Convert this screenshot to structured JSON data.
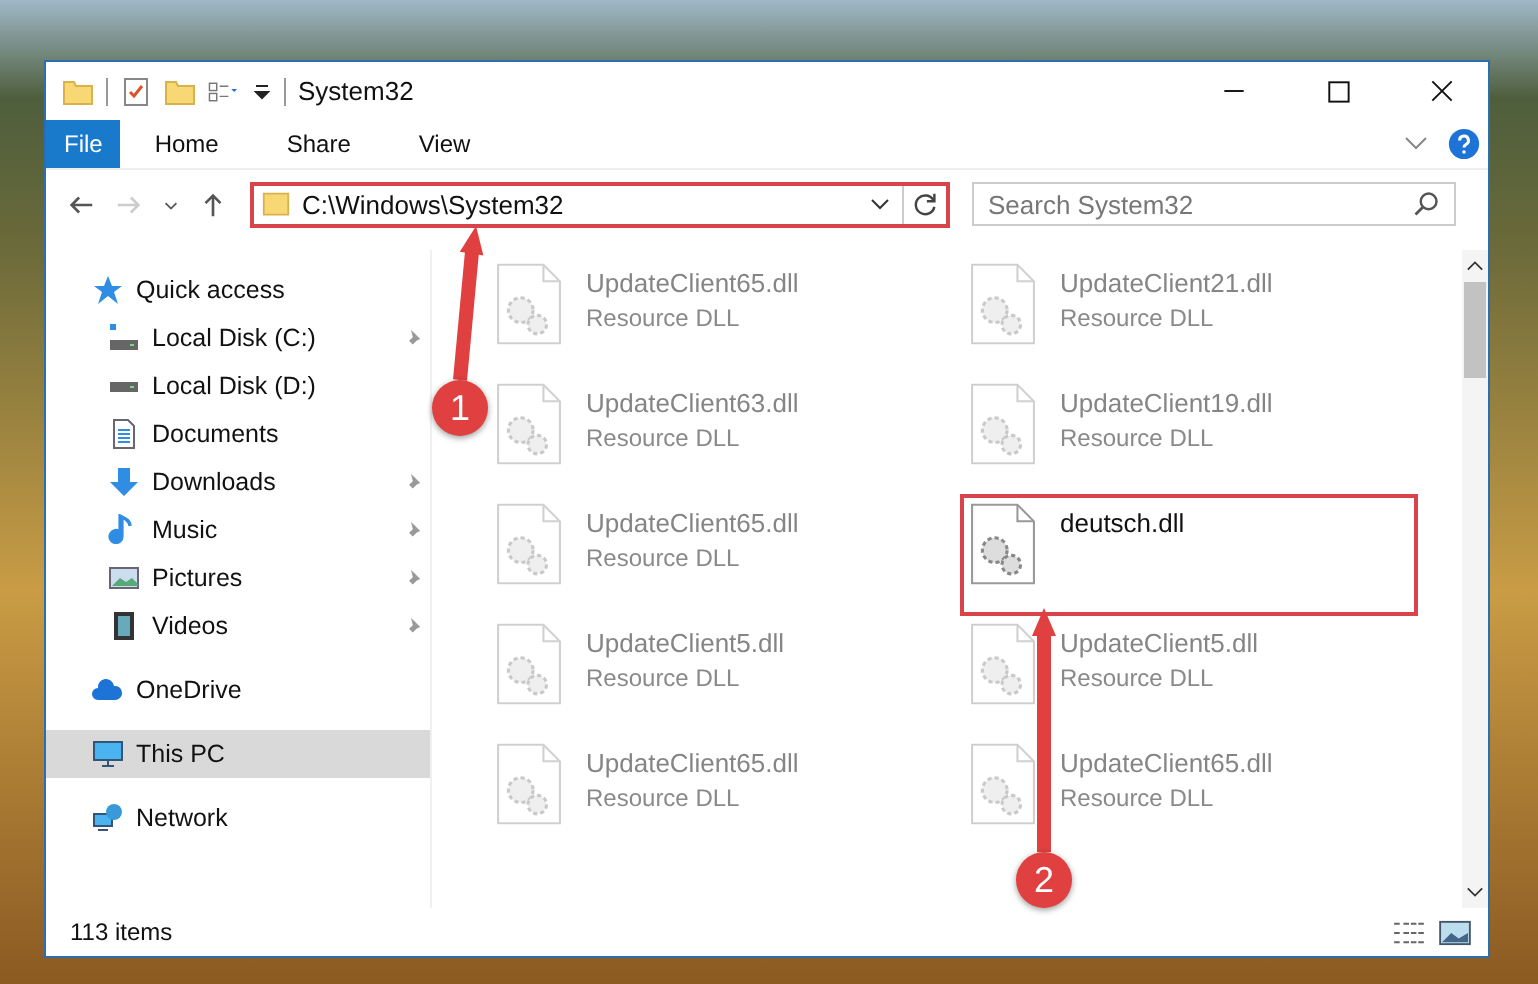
{
  "window": {
    "title": "System32"
  },
  "ribbon_tabs": [
    {
      "label": "File",
      "kind": "file"
    },
    {
      "label": "Home",
      "kind": "tab"
    },
    {
      "label": "Share",
      "kind": "tab"
    },
    {
      "label": "View",
      "kind": "tab"
    }
  ],
  "nav": {
    "back_disabled": false,
    "forward_disabled": true
  },
  "address": {
    "path": "C:\\Windows\\System32",
    "highlighted": true
  },
  "search": {
    "placeholder": "Search System32"
  },
  "sidebar": {
    "items": [
      {
        "label": "Quick access",
        "kind": "star",
        "selected": false,
        "children": [
          {
            "label": "Local Disk (C:)",
            "kind": "windisk",
            "pinned": true,
            "selected": false
          },
          {
            "label": "Local Disk (D:)",
            "kind": "disk",
            "pinned": false,
            "selected": false
          },
          {
            "label": "Documents",
            "kind": "doc",
            "pinned": false,
            "selected": false
          },
          {
            "label": "Downloads",
            "kind": "download",
            "pinned": true,
            "selected": false
          },
          {
            "label": "Music",
            "kind": "music",
            "pinned": true,
            "selected": false
          },
          {
            "label": "Pictures",
            "kind": "picture",
            "pinned": true,
            "selected": false
          },
          {
            "label": "Videos",
            "kind": "video",
            "pinned": true,
            "selected": false
          }
        ]
      },
      {
        "label": "OneDrive",
        "kind": "cloud",
        "selected": false
      },
      {
        "label": "This PC",
        "kind": "pc",
        "selected": true
      },
      {
        "label": "Network",
        "kind": "network",
        "selected": false
      }
    ]
  },
  "files": [
    {
      "name": "UpdateClient65.dll",
      "type": "Resource DLL",
      "dimmed": true,
      "highlighted": false
    },
    {
      "name": "UpdateClient21.dll",
      "type": "Resource DLL",
      "dimmed": true,
      "highlighted": false
    },
    {
      "name": "UpdateClient63.dll",
      "type": "Resource DLL",
      "dimmed": true,
      "highlighted": false
    },
    {
      "name": "UpdateClient19.dll",
      "type": "Resource DLL",
      "dimmed": true,
      "highlighted": false
    },
    {
      "name": "UpdateClient65.dll",
      "type": "Resource DLL",
      "dimmed": true,
      "highlighted": false
    },
    {
      "name": "deutsch.dll",
      "dimmed": false,
      "highlighted": true
    },
    {
      "name": "UpdateClient5.dll",
      "type": "Resource DLL",
      "dimmed": true,
      "highlighted": false
    },
    {
      "name": "UpdateClient5.dll",
      "type": "Resource DLL",
      "dimmed": true,
      "highlighted": false
    },
    {
      "name": "UpdateClient65.dll",
      "type": "Resource DLL",
      "dimmed": true,
      "highlighted": false
    },
    {
      "name": "UpdateClient65.dll",
      "type": "Resource DLL",
      "dimmed": true,
      "highlighted": false
    }
  ],
  "callouts": [
    {
      "number": "1"
    },
    {
      "number": "2"
    }
  ],
  "status_bar": {
    "item_count": "113 items"
  }
}
